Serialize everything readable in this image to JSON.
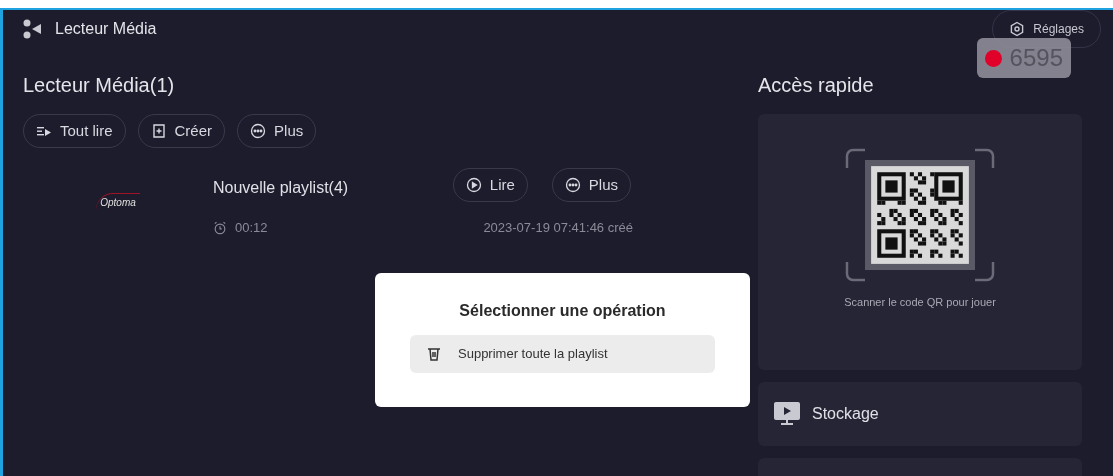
{
  "app_bar": {
    "title": "Lecteur Média",
    "settings_button": "Réglages"
  },
  "recording_badge": {
    "count": "6595"
  },
  "library": {
    "title": "Lecteur Média(1)",
    "actions": [
      {
        "kind": "play-all",
        "label": "Tout lire"
      },
      {
        "kind": "create",
        "label": "Créer"
      },
      {
        "kind": "more",
        "label": "Plus"
      }
    ],
    "playlists": [
      {
        "logo": "Optoma",
        "name": "Nouvelle playlist(4)",
        "duration": "00:12",
        "created": "2023-07-19 07:41:46 créé",
        "actions": [
          {
            "kind": "play",
            "label": "Lire"
          },
          {
            "kind": "more",
            "label": "Plus"
          }
        ]
      }
    ]
  },
  "quick_access": {
    "title": "Accès rapide",
    "qr_caption": "Scanner le code QR pour jouer",
    "items": [
      {
        "label": "Stockage"
      }
    ]
  },
  "dialog": {
    "title": "Sélectionner une opération",
    "options": [
      {
        "kind": "delete",
        "label": "Supprimer toute la playlist"
      }
    ]
  }
}
